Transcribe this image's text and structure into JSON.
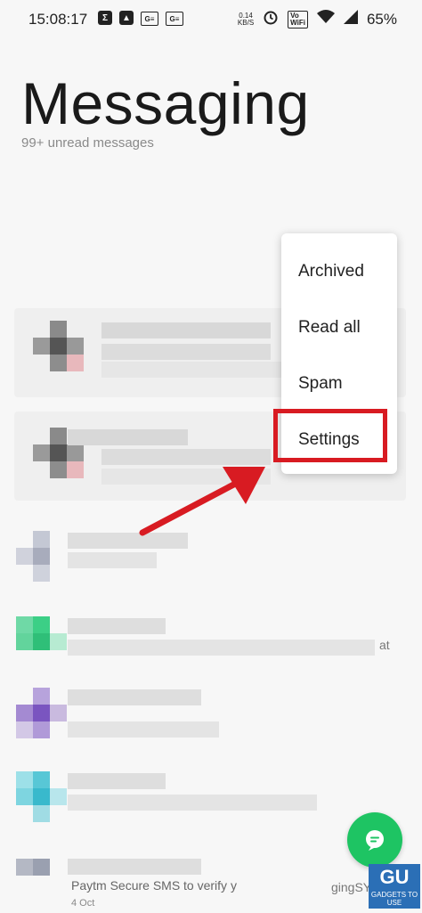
{
  "status_bar": {
    "time": "15:08:17",
    "net_speed_value": "0.14",
    "net_speed_unit": "KB/S",
    "vo_label": "Vo",
    "wifi_label": "WiFi",
    "battery": "65%"
  },
  "header": {
    "title": "Messaging",
    "subtitle": "99+ unread messages"
  },
  "menu": {
    "items": [
      {
        "label": "Archived"
      },
      {
        "label": "Read all"
      },
      {
        "label": "Spam"
      },
      {
        "label": "Settings"
      }
    ]
  },
  "conversations": [
    {
      "avatar_color": "#7a7a7a",
      "preview_tail": ""
    },
    {
      "avatar_color": "#6a6a6a",
      "preview_tail": ""
    },
    {
      "avatar_color": "#c9ccd8",
      "preview_tail": ""
    },
    {
      "avatar_color": "#3ccf86",
      "preview_tail": "at"
    },
    {
      "avatar_color": "#8e6fc4",
      "preview_tail": ""
    },
    {
      "avatar_color": "#58c7d6",
      "preview_tail": ""
    },
    {
      "avatar_color": "#9aa0b0",
      "preview_tail": "gingSY"
    }
  ],
  "footer_item": {
    "preview": "Paytm Secure SMS to verify y",
    "date": "4 Oct"
  },
  "colors": {
    "accent_highlight": "#d81b22",
    "fab": "#1ec463"
  },
  "watermark": "GADGETS TO USE"
}
